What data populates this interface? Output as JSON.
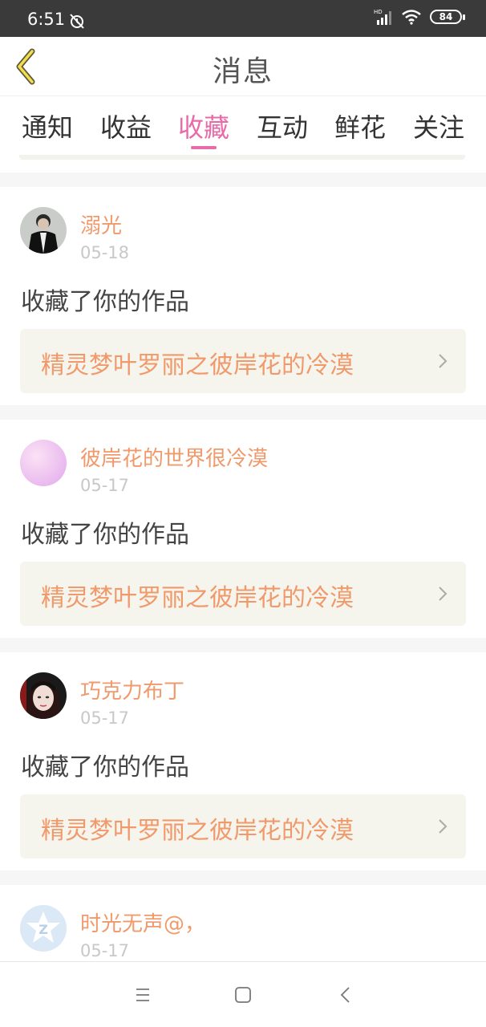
{
  "status_bar": {
    "time": "6:51",
    "battery": "84",
    "hd": "HD"
  },
  "header": {
    "title": "消息"
  },
  "tabs": [
    {
      "label": "通知"
    },
    {
      "label": "收益"
    },
    {
      "label": "收藏",
      "active": true
    },
    {
      "label": "互动"
    },
    {
      "label": "鲜花"
    },
    {
      "label": "关注"
    }
  ],
  "messages": [
    {
      "user": "溺光",
      "date": "05-18",
      "action": "收藏了你的作品",
      "work": "精灵梦叶罗丽之彼岸花的冷漠",
      "avatar": "avatar-man-in-suit"
    },
    {
      "user": "彼岸花的世界很冷漠",
      "date": "05-17",
      "action": "收藏了你的作品",
      "work": "精灵梦叶罗丽之彼岸花的冷漠",
      "avatar": "avatar-pink-gradient"
    },
    {
      "user": "巧克力布丁",
      "date": "05-17",
      "action": "收藏了你的作品",
      "work": "精灵梦叶罗丽之彼岸花的冷漠",
      "avatar": "avatar-girl-photo"
    },
    {
      "user": "时光无声@，",
      "date": "05-17",
      "avatar": "avatar-default-z"
    }
  ],
  "colors": {
    "accent": "#e96aa8",
    "username": "#f09a6c",
    "work_bg": "#f5f5ee"
  }
}
